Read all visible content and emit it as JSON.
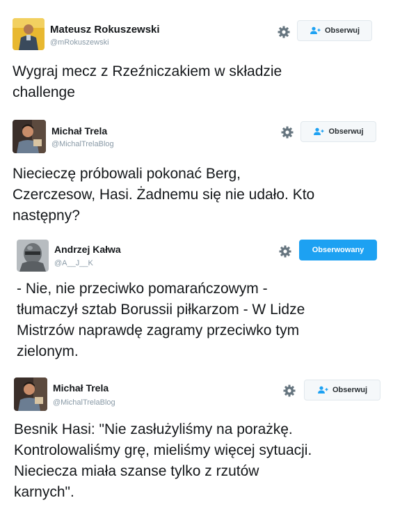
{
  "colors": {
    "handle": "#8899a6",
    "follow_button_bg": "#f5f8fa",
    "following_button_bg": "#1da1f2",
    "follow_icon": "#1da1f2"
  },
  "tweets": [
    {
      "name": "Mateusz Rokuszewski",
      "handle": "@mRokuszewski",
      "button_label": "Obserwuj",
      "following": false,
      "text_lines": [
        "Wygraj mecz z Rzeźniczakiem w składzie",
        "challenge"
      ]
    },
    {
      "name": "Michał Trela",
      "handle": "@MichalTrelaBlog",
      "button_label": "Obserwuj",
      "following": false,
      "text_lines": [
        "Niecieczę próbowali pokonać Berg,",
        "Czerczesow, Hasi. Żadnemu się nie udało. Kto",
        "następny?"
      ]
    },
    {
      "name": "Andrzej Kałwa",
      "handle": "@A__J__K",
      "button_label": "Obserwowany",
      "following": true,
      "text_lines": [
        "- Nie, nie przeciwko pomarańczowym -",
        "tłumaczył sztab Borussii piłkarzom - W Lidze",
        "Mistrzów naprawdę zagramy przeciwko tym",
        "zielonym."
      ]
    },
    {
      "name": "Michał Trela",
      "handle": "@MichalTrelaBlog",
      "button_label": "Obserwuj",
      "following": false,
      "text_lines": [
        "Besnik Hasi: \"Nie zasłużyliśmy na porażkę.",
        "Kontrolowaliśmy grę, mieliśmy więcej sytuacji.",
        "Nieciecza miała szanse tylko z rzutów",
        "karnych\"."
      ]
    }
  ]
}
